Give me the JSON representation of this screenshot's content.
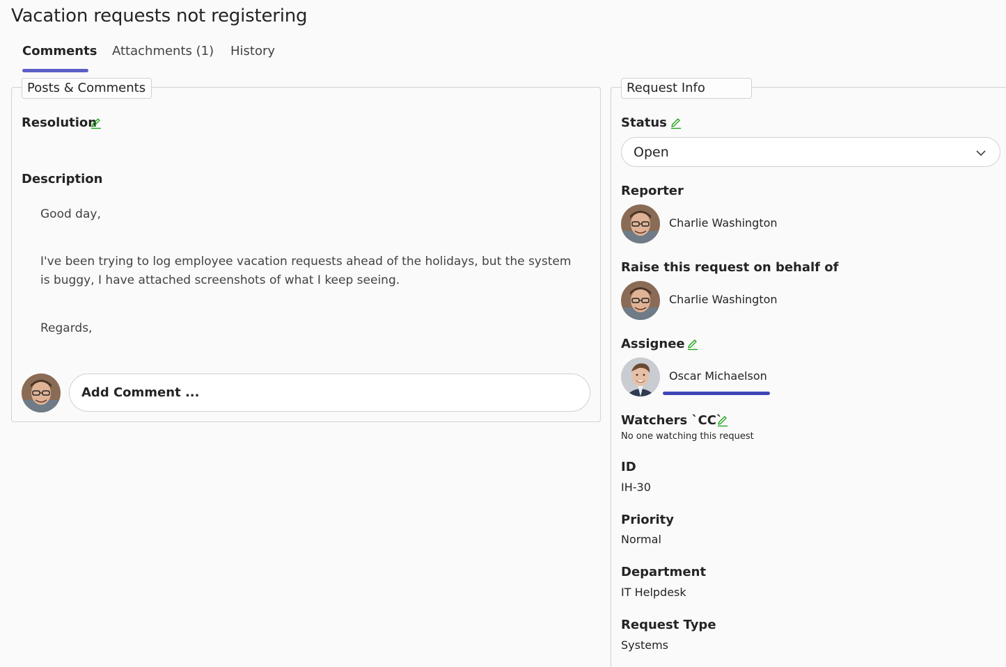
{
  "page": {
    "title": "Vacation requests not registering"
  },
  "tabs": [
    {
      "label": "Comments",
      "active": true
    },
    {
      "label": "Attachments (1)",
      "active": false
    },
    {
      "label": "History",
      "active": false
    }
  ],
  "left_panel": {
    "legend": "Posts & Comments",
    "resolution_label": "Resolution",
    "description_label": "Description",
    "description_lines": [
      "Good day,",
      "I've been trying to log employee vacation requests ahead of the holidays, but the system is buggy, I have attached screenshots of what I keep seeing.",
      "Regards,"
    ],
    "comment_placeholder": "Add Comment ..."
  },
  "right_panel": {
    "legend": "Request Info",
    "status": {
      "label": "Status",
      "value": "Open"
    },
    "reporter": {
      "label": "Reporter",
      "name": "Charlie Washington"
    },
    "on_behalf": {
      "label": "Raise this request on behalf of",
      "name": "Charlie Washington"
    },
    "assignee": {
      "label": "Assignee",
      "name": "Oscar Michaelson"
    },
    "watchers": {
      "label": "Watchers `CC`",
      "value": "No one watching this request"
    },
    "id": {
      "label": "ID",
      "value": "IH-30"
    },
    "priority": {
      "label": "Priority",
      "value": "Normal"
    },
    "department": {
      "label": "Department",
      "value": "IT Helpdesk"
    },
    "request_type": {
      "label": "Request Type",
      "value": "Systems"
    }
  },
  "colors": {
    "accent": "#5b5fc7",
    "edit_icon": "#13a10e",
    "assignee_bar": "#4046b8"
  },
  "icons": {
    "edit": "pencil-icon",
    "dropdown": "chevron-down-icon"
  }
}
